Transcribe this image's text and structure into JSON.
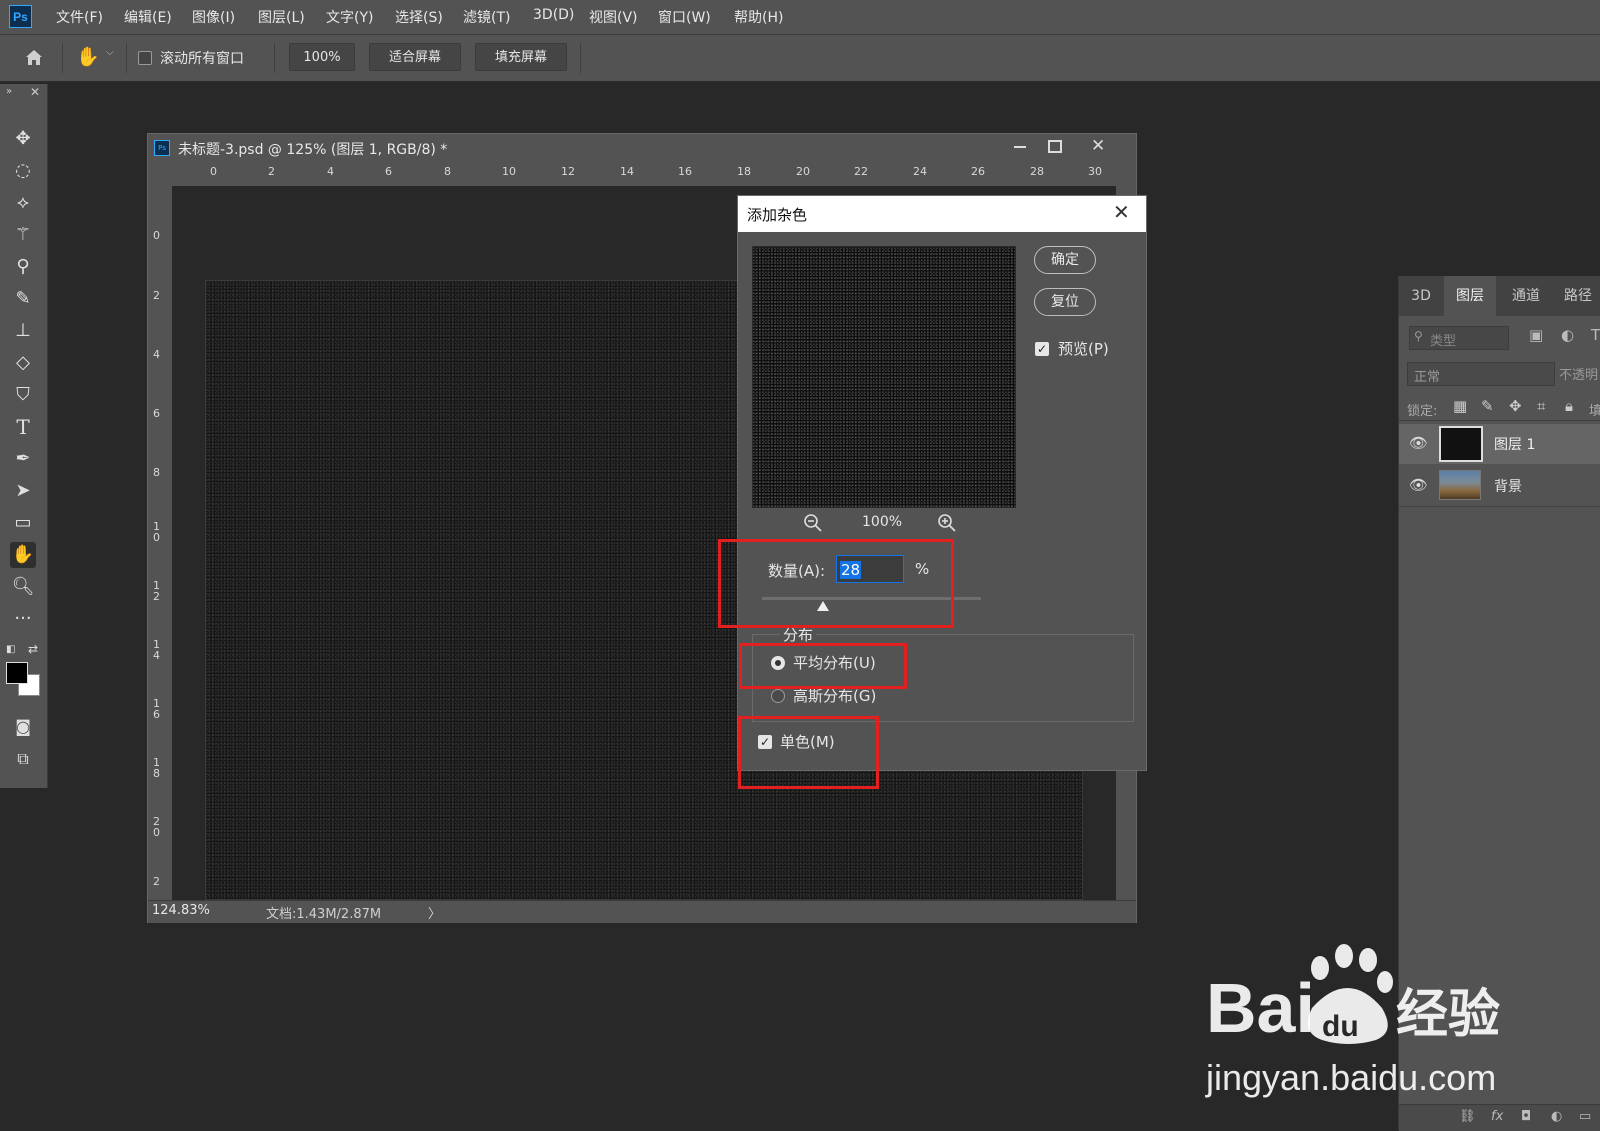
{
  "app": {
    "logo": "Ps"
  },
  "menu": [
    "文件(F)",
    "编辑(E)",
    "图像(I)",
    "图层(L)",
    "文字(Y)",
    "选择(S)",
    "滤镜(T)",
    "3D(D)",
    "视图(V)",
    "窗口(W)",
    "帮助(H)"
  ],
  "options": {
    "scroll_all_label": "滚动所有窗口",
    "zoom_value": "100%",
    "fit_screen": "适合屏幕",
    "fill_screen": "填充屏幕"
  },
  "tools": [
    "move-icon",
    "lasso-icon",
    "polygon-lasso-icon",
    "magic-wand-icon",
    "eyedropper-icon",
    "brush-icon",
    "stamp-icon",
    "eraser-icon",
    "paint-bucket-icon",
    "type-icon",
    "pen-icon",
    "path-select-icon",
    "rectangle-icon",
    "hand-icon",
    "zoom-icon",
    "more-icon"
  ],
  "document": {
    "title": "未标题-3.psd @ 125% (图层 1, RGB/8) *",
    "ruler_h": [
      "0",
      "2",
      "4",
      "6",
      "8",
      "10",
      "12",
      "14",
      "16",
      "18",
      "20",
      "22",
      "24",
      "26",
      "28",
      "30"
    ],
    "ruler_v": [
      "0",
      "2",
      "4",
      "6",
      "8",
      "10",
      "12",
      "14",
      "16",
      "18",
      "20",
      "2"
    ],
    "zoom": "124.83%",
    "doc_info": "文档:1.43M/2.87M",
    "status_arrow": "〉"
  },
  "dialog": {
    "title": "添加杂色",
    "ok": "确定",
    "reset": "复位",
    "preview_label": "预览(P)",
    "preview_checked": true,
    "preview_zoom": "100%",
    "amount_label": "数量(A):",
    "amount_value": "28",
    "amount_unit": "%",
    "amount_fraction": 0.28,
    "distribution_label": "分布",
    "uniform_label": "平均分布(U)",
    "gaussian_label": "高斯分布(G)",
    "selected_distribution": "uniform",
    "mono_label": "单色(M)",
    "mono_checked": true
  },
  "panel": {
    "tabs": [
      "3D",
      "图层",
      "通道",
      "路径"
    ],
    "active_tab": "图层",
    "filter_placeholder": "类型",
    "blend_mode": "正常",
    "opacity_label": "不透明",
    "lock_label": "锁定:",
    "fill_label": "填",
    "layers": [
      {
        "name": "图层 1",
        "selected": true
      },
      {
        "name": "背景",
        "selected": false
      }
    ]
  },
  "watermark": {
    "brand": "Bai",
    "paw_text": "du",
    "brand_cn": "经验",
    "url": "jingyan.baidu.com"
  },
  "colors": {
    "highlight": "#e32020",
    "selection": "#1473e6",
    "ui_bg": "#535353",
    "canvas_bg": "#282828"
  }
}
